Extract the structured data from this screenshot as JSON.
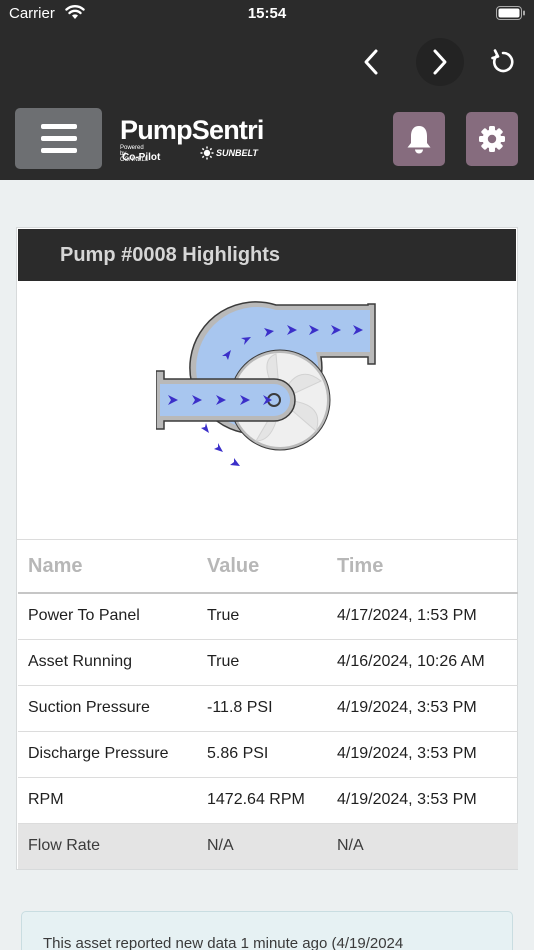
{
  "status_bar": {
    "carrier": "Carrier",
    "time": "15:54"
  },
  "nav_icons": {
    "back": "chevron-left-icon",
    "forward": "chevron-right-icon",
    "reload": "reload-icon"
  },
  "header": {
    "brand": "PumpSentri",
    "powered_by": "Powered by CONNELL",
    "copilot": "Co-Pilot",
    "sunbelt": "SUNBELT",
    "icons": {
      "menu": "menu-icon",
      "alerts": "bell-icon",
      "settings": "gear-icon"
    }
  },
  "colors": {
    "dark": "#2b2b2b",
    "menu_button": "#6d6f72",
    "accent": "#866c7e",
    "flow": "#3b2fc9",
    "background": "#ecf0f1"
  },
  "card": {
    "title": "Pump #0008 Highlights",
    "columns": [
      "Name",
      "Value",
      "Time"
    ],
    "rows": [
      {
        "name": "Power To Panel",
        "value": "True",
        "time": "4/17/2024, 1:53 PM"
      },
      {
        "name": "Asset Running",
        "value": "True",
        "time": "4/16/2024, 10:26 AM"
      },
      {
        "name": "Suction Pressure",
        "value": "-11.8 PSI",
        "time": "4/19/2024, 3:53 PM"
      },
      {
        "name": "Discharge Pressure",
        "value": "5.86 PSI",
        "time": "4/19/2024, 3:53 PM"
      },
      {
        "name": "RPM",
        "value": "1472.64 RPM",
        "time": "4/19/2024, 3:53 PM"
      },
      {
        "name": "Flow Rate",
        "value": "N/A",
        "time": "N/A"
      }
    ]
  },
  "notice": {
    "text": "This asset reported new data 1 minute ago (4/19/2024"
  }
}
